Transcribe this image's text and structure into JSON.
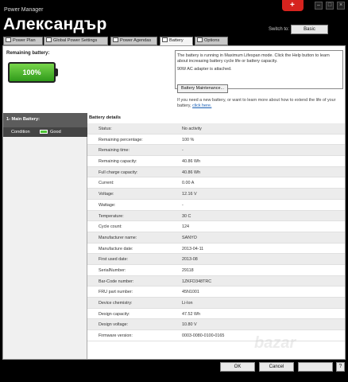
{
  "window": {
    "app_title": "Power Manager",
    "overlay_name": "Александър",
    "switch_label": "Switch to:",
    "switch_value": "Basic"
  },
  "tabs": [
    {
      "label": "Power Plan"
    },
    {
      "label": "Global Power Settings"
    },
    {
      "label": "Power Agendas"
    },
    {
      "label": "Battery"
    },
    {
      "label": "Options"
    }
  ],
  "battery": {
    "remaining_label": "Remaining battery:",
    "percent_text": "100%",
    "level": 1.0,
    "info_line1": "The battery is running in Maximum Lifespan mode. Click the Help button to learn about increasing battery cycle life or battery capacity.",
    "info_line2": "90W AC adapter is attached.",
    "maintenance_button": "Battery Maintenance...",
    "need_text": "If you need a new battery, or want to learn more about how to extend the life of your battery,",
    "need_link": "click here."
  },
  "sidebar": {
    "header": "1- Main Battery:",
    "condition_label": "Condition",
    "condition_value": "Good"
  },
  "details": {
    "header": "Battery details",
    "rows": [
      {
        "label": "Status:",
        "value": "No activity"
      },
      {
        "label": "Remaining percentage:",
        "value": "100 %"
      },
      {
        "label": "Remaining time:",
        "value": "-"
      },
      {
        "label": "Remaining capacity:",
        "value": "40.86 Wh"
      },
      {
        "label": "Full charge capacity:",
        "value": "40.86 Wh"
      },
      {
        "label": "Current:",
        "value": "0.00 A"
      },
      {
        "label": "Voltage:",
        "value": "12.16 V"
      },
      {
        "label": "Wattage:",
        "value": "-"
      },
      {
        "label": "Temperature:",
        "value": "30 C"
      },
      {
        "label": "Cycle count:",
        "value": "124"
      },
      {
        "label": "Manufacturer name:",
        "value": "SANYO"
      },
      {
        "label": "Manufacture date:",
        "value": "2013-04-11"
      },
      {
        "label": "First used date:",
        "value": "2013-08"
      },
      {
        "label": "SerialNumber:",
        "value": "29118"
      },
      {
        "label": "Bar-Code number:",
        "value": "1ZKFD348TRC"
      },
      {
        "label": "FRU part number:",
        "value": "45N1001"
      },
      {
        "label": "Device chemistry:",
        "value": "Li-Ion"
      },
      {
        "label": "Design capacity:",
        "value": "47.52 Wh"
      },
      {
        "label": "Design voltage:",
        "value": "10.80 V"
      },
      {
        "label": "Firmware version:",
        "value": "0003-0080-0100-0165"
      }
    ]
  },
  "footer": {
    "ok_label": "OK",
    "cancel_label": "Cancel"
  },
  "colors": {
    "battery_green": "#2f9a1a",
    "accent_red": "#d6231e",
    "link_blue": "#1a5fb4"
  }
}
